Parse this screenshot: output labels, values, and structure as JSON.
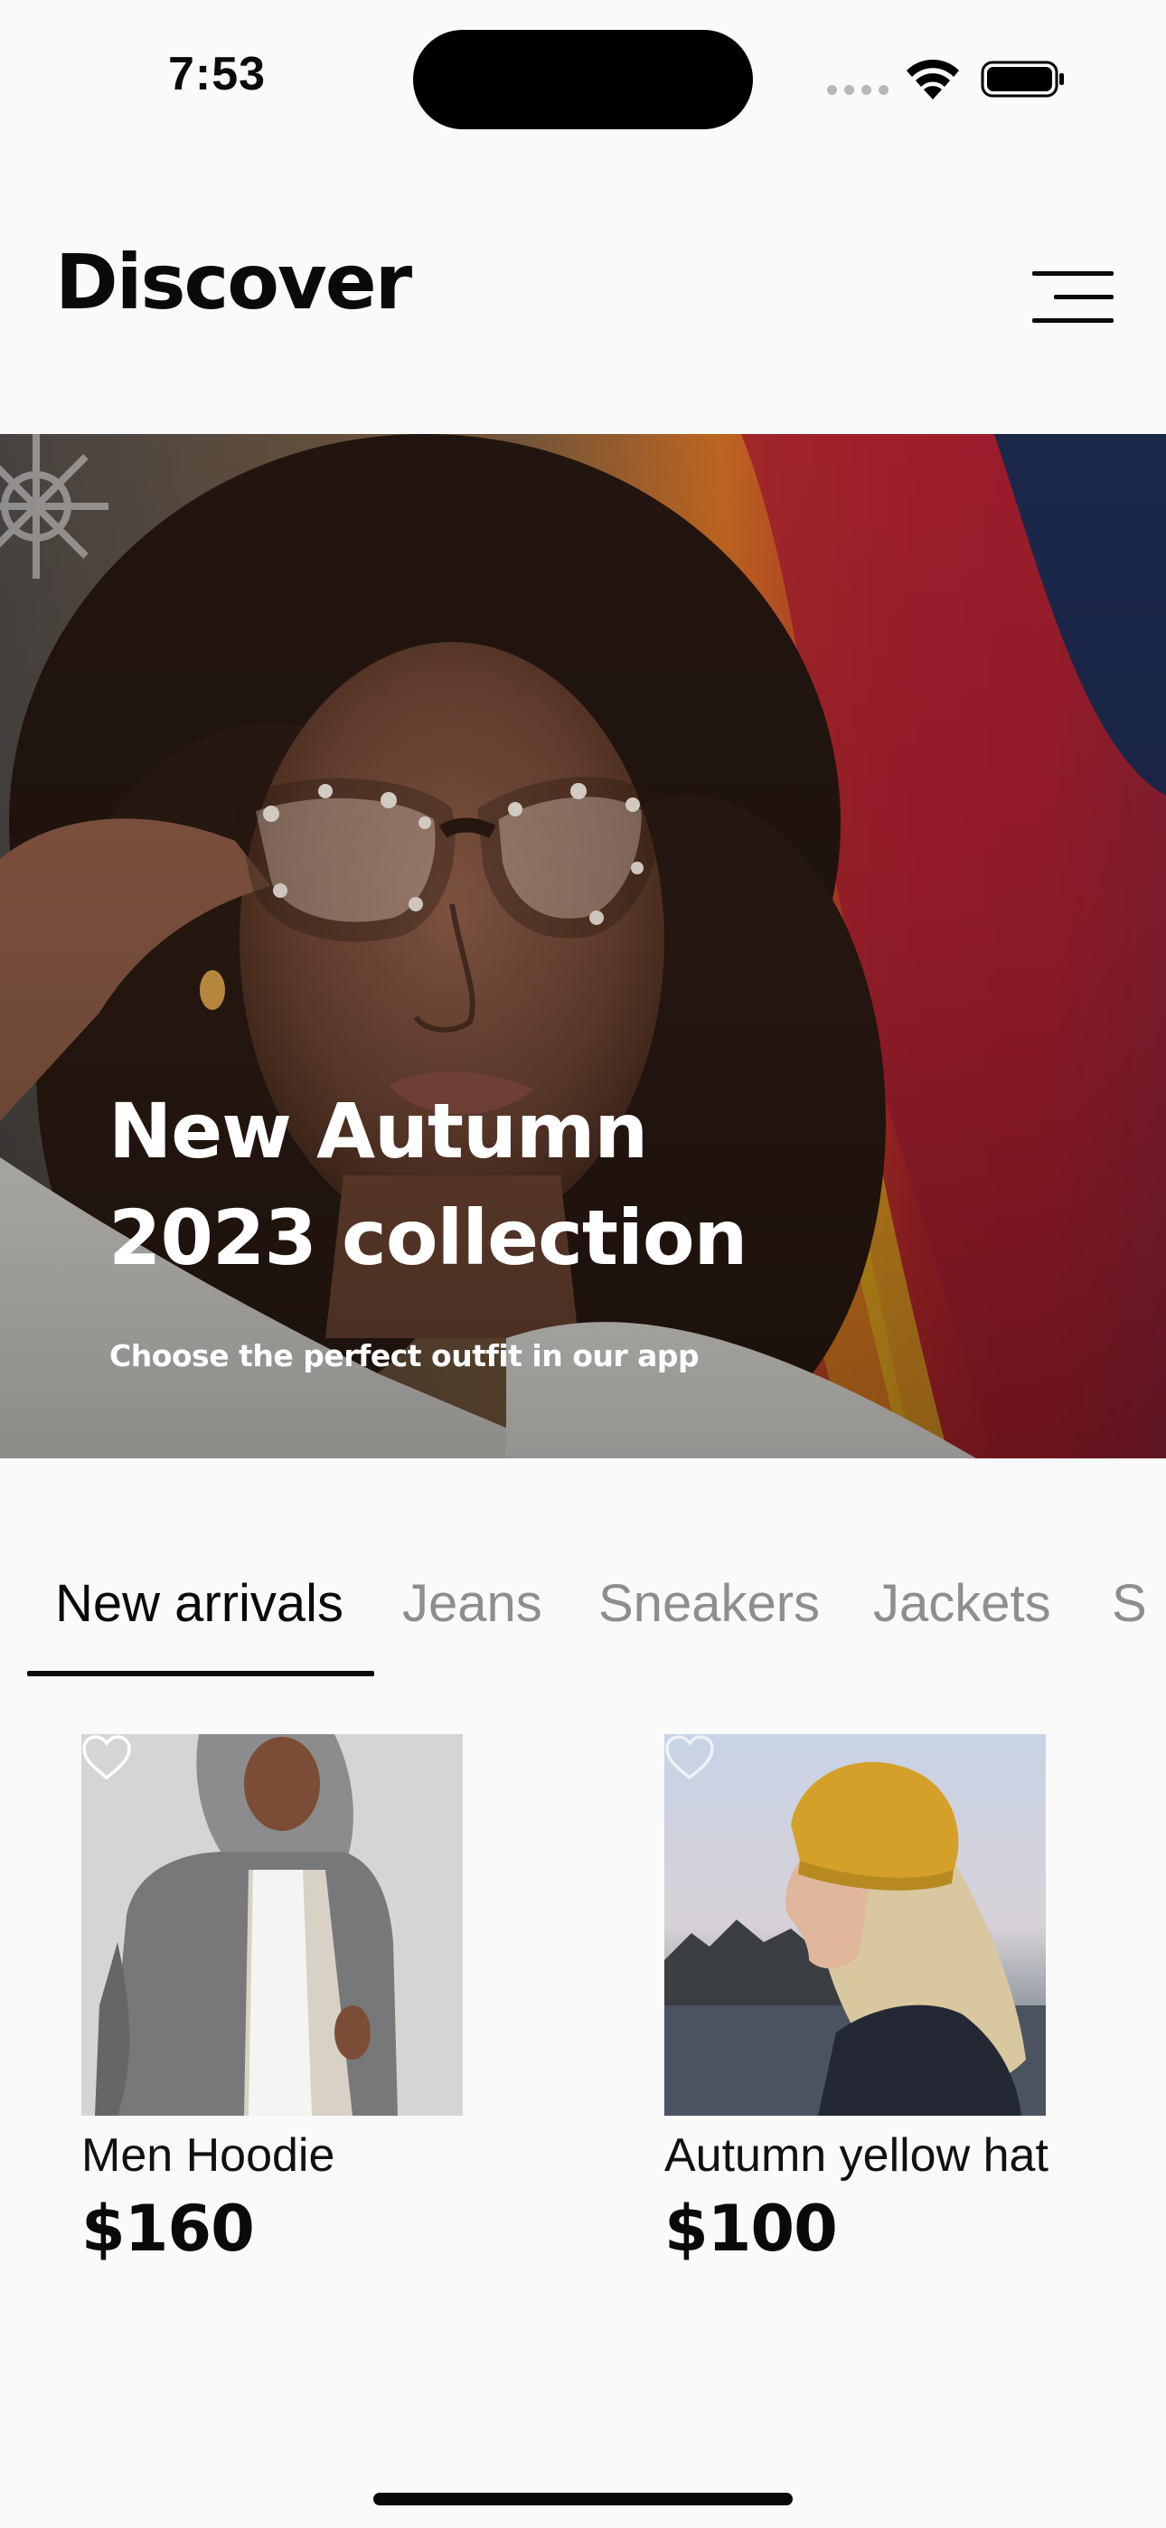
{
  "status_bar": {
    "time": "7:53"
  },
  "header": {
    "title": "Discover",
    "menu_icon": "menu-icon"
  },
  "hero": {
    "title_line1": "New Autumn",
    "title_line2": "2023 collection",
    "subtitle": "Choose the perfect outfit in our app"
  },
  "tabs": [
    {
      "label": "New arrivals",
      "active": true
    },
    {
      "label": "Jeans",
      "active": false
    },
    {
      "label": "Sneakers",
      "active": false
    },
    {
      "label": "Jackets",
      "active": false
    },
    {
      "label": "S",
      "active": false
    }
  ],
  "products": [
    {
      "name": "Men Hoodie",
      "price": "$160",
      "icon": "heart-icon"
    },
    {
      "name": "Autumn yellow hat",
      "price": "$100",
      "icon": "heart-icon"
    }
  ],
  "colors": {
    "text_primary": "#0a0a0a",
    "text_inactive": "#8e8e8e",
    "background": "#fafafa",
    "hero_text": "#ffffff"
  }
}
